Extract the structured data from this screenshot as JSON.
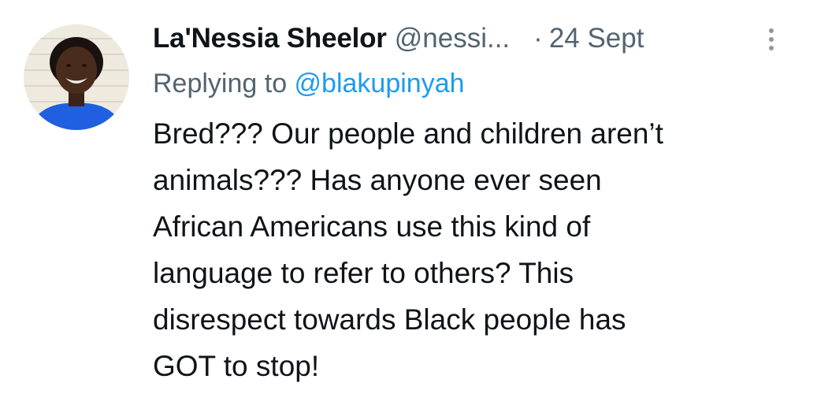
{
  "tweet": {
    "author": {
      "display_name": "La'Nessia Sheelor",
      "handle": "@nessi...",
      "avatar_icon": "profile-photo-avatar"
    },
    "separator": "·",
    "timestamp": "24 Sept",
    "more_icon": "more-vertical-icon",
    "reply": {
      "prefix": "Replying to",
      "mention": "@blakupinyah"
    },
    "text_lines": [
      "Bred??? Our people and children aren’t",
      "animals??? Has anyone ever seen",
      "African Americans use this kind of",
      "language to refer to others? This",
      "disrespect towards Black people has",
      "GOT to stop!"
    ]
  },
  "colors": {
    "primary_text": "#0f1419",
    "secondary_text": "#536471",
    "link": "#1d9bf0",
    "background": "#ffffff"
  }
}
